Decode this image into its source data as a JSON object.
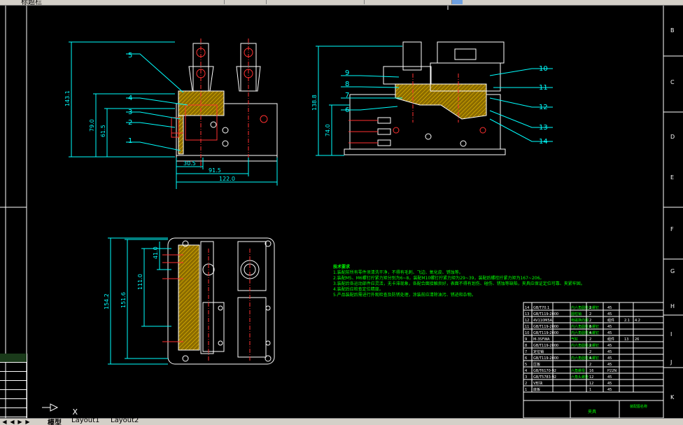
{
  "toolbar": {
    "label": "标题栏"
  },
  "views": {
    "front": {
      "dims": [
        "143.1",
        "79.0",
        "61.5",
        "30.5",
        "91.5",
        "122.0"
      ],
      "balloons": [
        "5",
        "4",
        "3",
        "2",
        "1"
      ]
    },
    "side": {
      "dims": [
        "138.8",
        "74.0"
      ],
      "balloons": [
        "9",
        "8",
        "7",
        "6",
        "10",
        "11",
        "12",
        "13",
        "14"
      ]
    },
    "top": {
      "dims": [
        "41.0",
        "111.0",
        "151.6",
        "154.2"
      ]
    }
  },
  "notes": {
    "title": "技术要求",
    "lines": [
      "1.装配前所有零件须清洗干净，不得有毛刺、飞边、氧化皮、锈蚀等。",
      "2.装配M5、M6螺钉拧紧力矩分别为6~8，装配M10螺钉拧紧力矩为29~39，装配后螺栓拧紧力矩为167~206。",
      "3.装配后各运动部件应灵活，无卡滞现象，各配合面接触良好，表面不得有划伤、碰伤、锈蚀等缺陷，夹具应保证定位可靠、夹紧牢固。",
      "4.装配后应检查定位精度。",
      "5.产品装配后需进行外观检查及防锈处理，涂装前应清除油污、锈迹和杂物。"
    ]
  },
  "bom": {
    "rows": [
      [
        "14",
        "GB/T70.1",
        "内六角圆柱头螺钉",
        "2",
        "45",
        "",
        ""
      ],
      [
        "13",
        "GB/T119-2000",
        "圆柱销",
        "2",
        "45",
        "",
        ""
      ],
      [
        "12",
        "4V110M5A",
        "电磁换向阀",
        "2",
        "组件",
        "2.1",
        "4.2"
      ],
      [
        "11",
        "GB/T119-2000",
        "内六角圆柱头螺钉",
        "8",
        "45",
        "",
        ""
      ],
      [
        "10",
        "GB/T119-2000",
        "内六角圆柱头螺钉",
        "4",
        "45",
        "",
        ""
      ],
      [
        "9",
        "M-3SFWA",
        "气缸",
        "2",
        "组件",
        "13",
        "26"
      ],
      [
        "8",
        "GB/T119-2000",
        "内六角圆柱头螺钉",
        "2",
        "45",
        "",
        ""
      ],
      [
        "7",
        "定位销",
        "",
        "2",
        "45",
        "",
        ""
      ],
      [
        "6",
        "GB/T119-2000",
        "内六角圆柱头螺钉",
        "4",
        "45",
        "",
        ""
      ],
      [
        "5",
        "压板",
        "",
        "2",
        "45",
        "",
        ""
      ],
      [
        "4",
        "GB/T6170-92",
        "六角螺母",
        "16",
        "P22N",
        "",
        ""
      ],
      [
        "3",
        "GB/T5783-92",
        "六角头螺栓",
        "12",
        "45",
        "",
        ""
      ],
      [
        "2",
        "V形块",
        "",
        "12",
        "45",
        "",
        ""
      ],
      [
        "1",
        "底板",
        "",
        "1",
        "45",
        "",
        ""
      ]
    ],
    "title_block": {
      "part_label": "夹具",
      "name": "装配图名称"
    }
  },
  "border": {
    "row_letters": [
      "B",
      "C",
      "D",
      "E",
      "F",
      "G",
      "H",
      "I",
      "J",
      "K"
    ]
  },
  "tabs": {
    "items": [
      "模型",
      "Layout1",
      "Layout2"
    ]
  },
  "ucs": {
    "label": "X"
  }
}
